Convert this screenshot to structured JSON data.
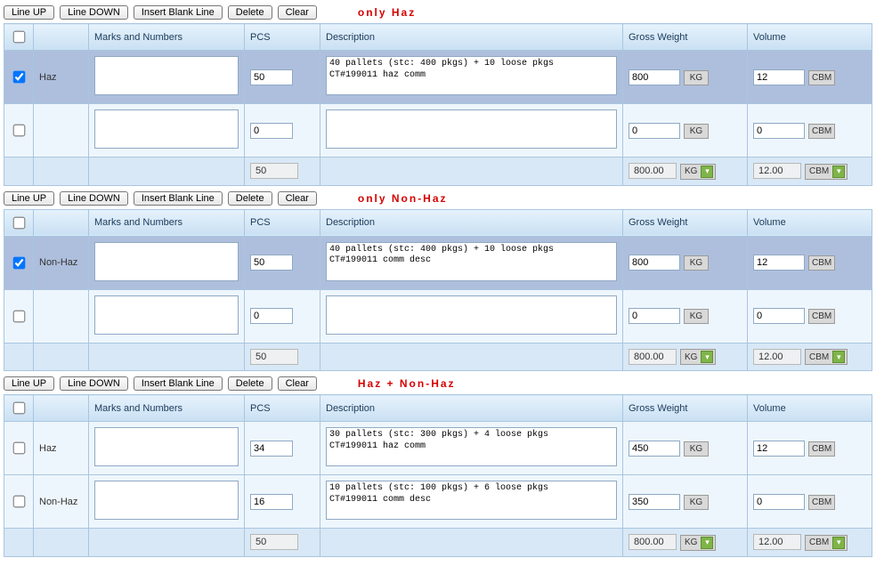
{
  "buttons": {
    "line_up": "Line UP",
    "line_down": "Line DOWN",
    "insert_blank": "Insert Blank Line",
    "delete": "Delete",
    "clear": "Clear"
  },
  "columns": {
    "marks": "Marks and Numbers",
    "pcs": "PCS",
    "desc": "Description",
    "gw": "Gross Weight",
    "vol": "Volume"
  },
  "units": {
    "kg": "KG",
    "cbm": "CBM"
  },
  "sections": [
    {
      "title": "only Haz",
      "rows": [
        {
          "checked": true,
          "selected": true,
          "tag": "Haz",
          "marks": "",
          "pcs": "50",
          "desc": "40 pallets (stc: 400 pkgs) + 10 loose pkgs\nCT#199011 haz comm",
          "gw": "800",
          "vol": "12"
        },
        {
          "checked": false,
          "selected": false,
          "tag": "",
          "marks": "",
          "pcs": "0",
          "desc": "",
          "gw": "0",
          "vol": "0"
        }
      ],
      "totals": {
        "pcs": "50",
        "gw": "800.00",
        "vol": "12.00"
      }
    },
    {
      "title": "only Non-Haz",
      "rows": [
        {
          "checked": true,
          "selected": true,
          "tag": "Non-Haz",
          "marks": "",
          "pcs": "50",
          "desc": "40 pallets (stc: 400 pkgs) + 10 loose pkgs\nCT#199011 comm desc",
          "gw": "800",
          "vol": "12"
        },
        {
          "checked": false,
          "selected": false,
          "tag": "",
          "marks": "",
          "pcs": "0",
          "desc": "",
          "gw": "0",
          "vol": "0"
        }
      ],
      "totals": {
        "pcs": "50",
        "gw": "800.00",
        "vol": "12.00"
      }
    },
    {
      "title": "Haz + Non-Haz",
      "rows": [
        {
          "checked": false,
          "selected": false,
          "tag": "Haz",
          "marks": "",
          "pcs": "34",
          "desc": "30 pallets (stc: 300 pkgs) + 4 loose pkgs\nCT#199011 haz comm",
          "gw": "450",
          "vol": "12"
        },
        {
          "checked": false,
          "selected": false,
          "tag": "Non-Haz",
          "marks": "",
          "pcs": "16",
          "desc": "10 pallets (stc: 100 pkgs) + 6 loose pkgs\nCT#199011 comm desc",
          "gw": "350",
          "vol": "0"
        }
      ],
      "totals": {
        "pcs": "50",
        "gw": "800.00",
        "vol": "12.00"
      }
    }
  ]
}
